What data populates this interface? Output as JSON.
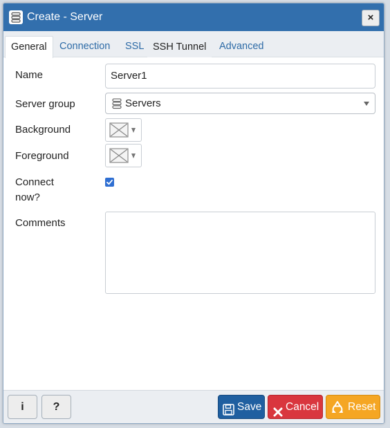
{
  "window": {
    "title": "Create - Server",
    "close_label": "×"
  },
  "tabs": [
    {
      "label": "General",
      "active": true
    },
    {
      "label": "Connection",
      "active": false
    },
    {
      "label": "SSL",
      "active": false
    },
    {
      "label": "SSH Tunnel",
      "active": false
    },
    {
      "label": "Advanced",
      "active": false
    }
  ],
  "form": {
    "name_label": "Name",
    "name_value": "Server1",
    "server_group_label": "Server group",
    "server_group_value": "Servers",
    "background_label": "Background",
    "foreground_label": "Foreground",
    "connect_now_label_line1": "Connect",
    "connect_now_label_line2": "now?",
    "connect_now_checked": true,
    "comments_label": "Comments",
    "comments_value": ""
  },
  "footer": {
    "info_label": "i",
    "help_label": "?",
    "save_label": "Save",
    "cancel_label": "Cancel",
    "reset_label": "Reset"
  },
  "colors": {
    "titlebar": "#326fad",
    "tab_link": "#2c6aa6",
    "save": "#1f5fa0",
    "cancel": "#d9363e",
    "reset": "#f5a623"
  },
  "icons": {
    "title": "server-icon",
    "group": "server-group-icon",
    "save": "floppy-disk-icon",
    "cancel": "x-icon",
    "reset": "recycle-icon"
  }
}
